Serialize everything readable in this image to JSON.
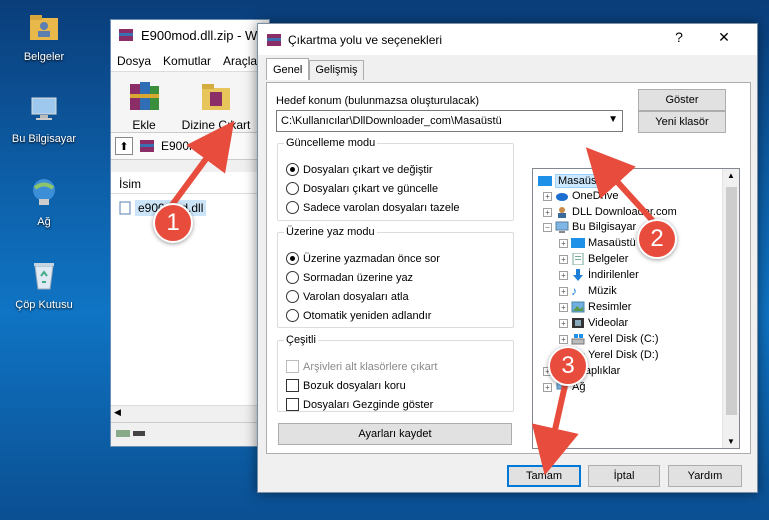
{
  "desktop": {
    "icons": [
      {
        "label": "Belgeler",
        "icon": "folder-user-icon"
      },
      {
        "label": "Bu Bilgisayar",
        "icon": "computer-icon"
      },
      {
        "label": "Ağ",
        "icon": "network-icon"
      },
      {
        "label": "Çöp Kutusu",
        "icon": "recycle-bin-icon"
      }
    ]
  },
  "winrar": {
    "title": "E900mod.dll.zip - W",
    "menu": [
      "Dosya",
      "Komutlar",
      "Araçla"
    ],
    "toolbar": {
      "add_label": "Ekle",
      "extract_label": "Dizine Çıkart"
    },
    "address": "E900mod.dl",
    "column_name": "İsim",
    "file": "e900mod.dll"
  },
  "dialog": {
    "title": "Çıkartma yolu ve seçenekleri",
    "help_glyph": "?",
    "close_glyph": "✕",
    "tabs": [
      "Genel",
      "Gelişmiş"
    ],
    "dest_label": "Hedef konum (bulunmazsa oluşturulacak)",
    "dest_value": "C:\\Kullanıcılar\\DllDownloader_com\\Masaüstü",
    "show_button": "Göster",
    "new_folder_button": "Yeni klasör",
    "update_mode": {
      "legend": "Güncelleme modu",
      "options": [
        "Dosyaları çıkart ve değiştir",
        "Dosyaları çıkart ve güncelle",
        "Sadece varolan dosyaları tazele"
      ],
      "selected": 0
    },
    "overwrite_mode": {
      "legend": "Üzerine yaz modu",
      "options": [
        "Üzerine yazmadan önce sor",
        "Sormadan üzerine yaz",
        "Varolan dosyaları atla",
        "Otomatik yeniden adlandır"
      ],
      "selected": 0
    },
    "misc": {
      "legend": "Çeşitli",
      "options": [
        "Arşivleri alt klasörlere çıkart",
        "Bozuk dosyaları koru",
        "Dosyaları Gezginde göster"
      ],
      "disabled": [
        true,
        false,
        false
      ],
      "checked": [
        false,
        false,
        false
      ]
    },
    "save_settings_button": "Ayarları kaydet",
    "tree": [
      "Masaüstü",
      "OneDrive",
      "DLL Downloader.com",
      "Bu Bilgisayar",
      "Masaüstü",
      "Belgeler",
      "İndirilenler",
      "Müzik",
      "Resimler",
      "Videolar",
      "Yerel Disk (C:)",
      "Yerel Disk (D:)",
      "Kitaplıklar",
      "Ağ"
    ],
    "ok_button": "Tamam",
    "cancel_button": "İptal",
    "help_button": "Yardım"
  },
  "callouts": [
    "1",
    "2",
    "3"
  ],
  "colors": {
    "callout": "#e84c3d",
    "selection": "#cce8ff",
    "default_button_border": "#0078d7"
  }
}
